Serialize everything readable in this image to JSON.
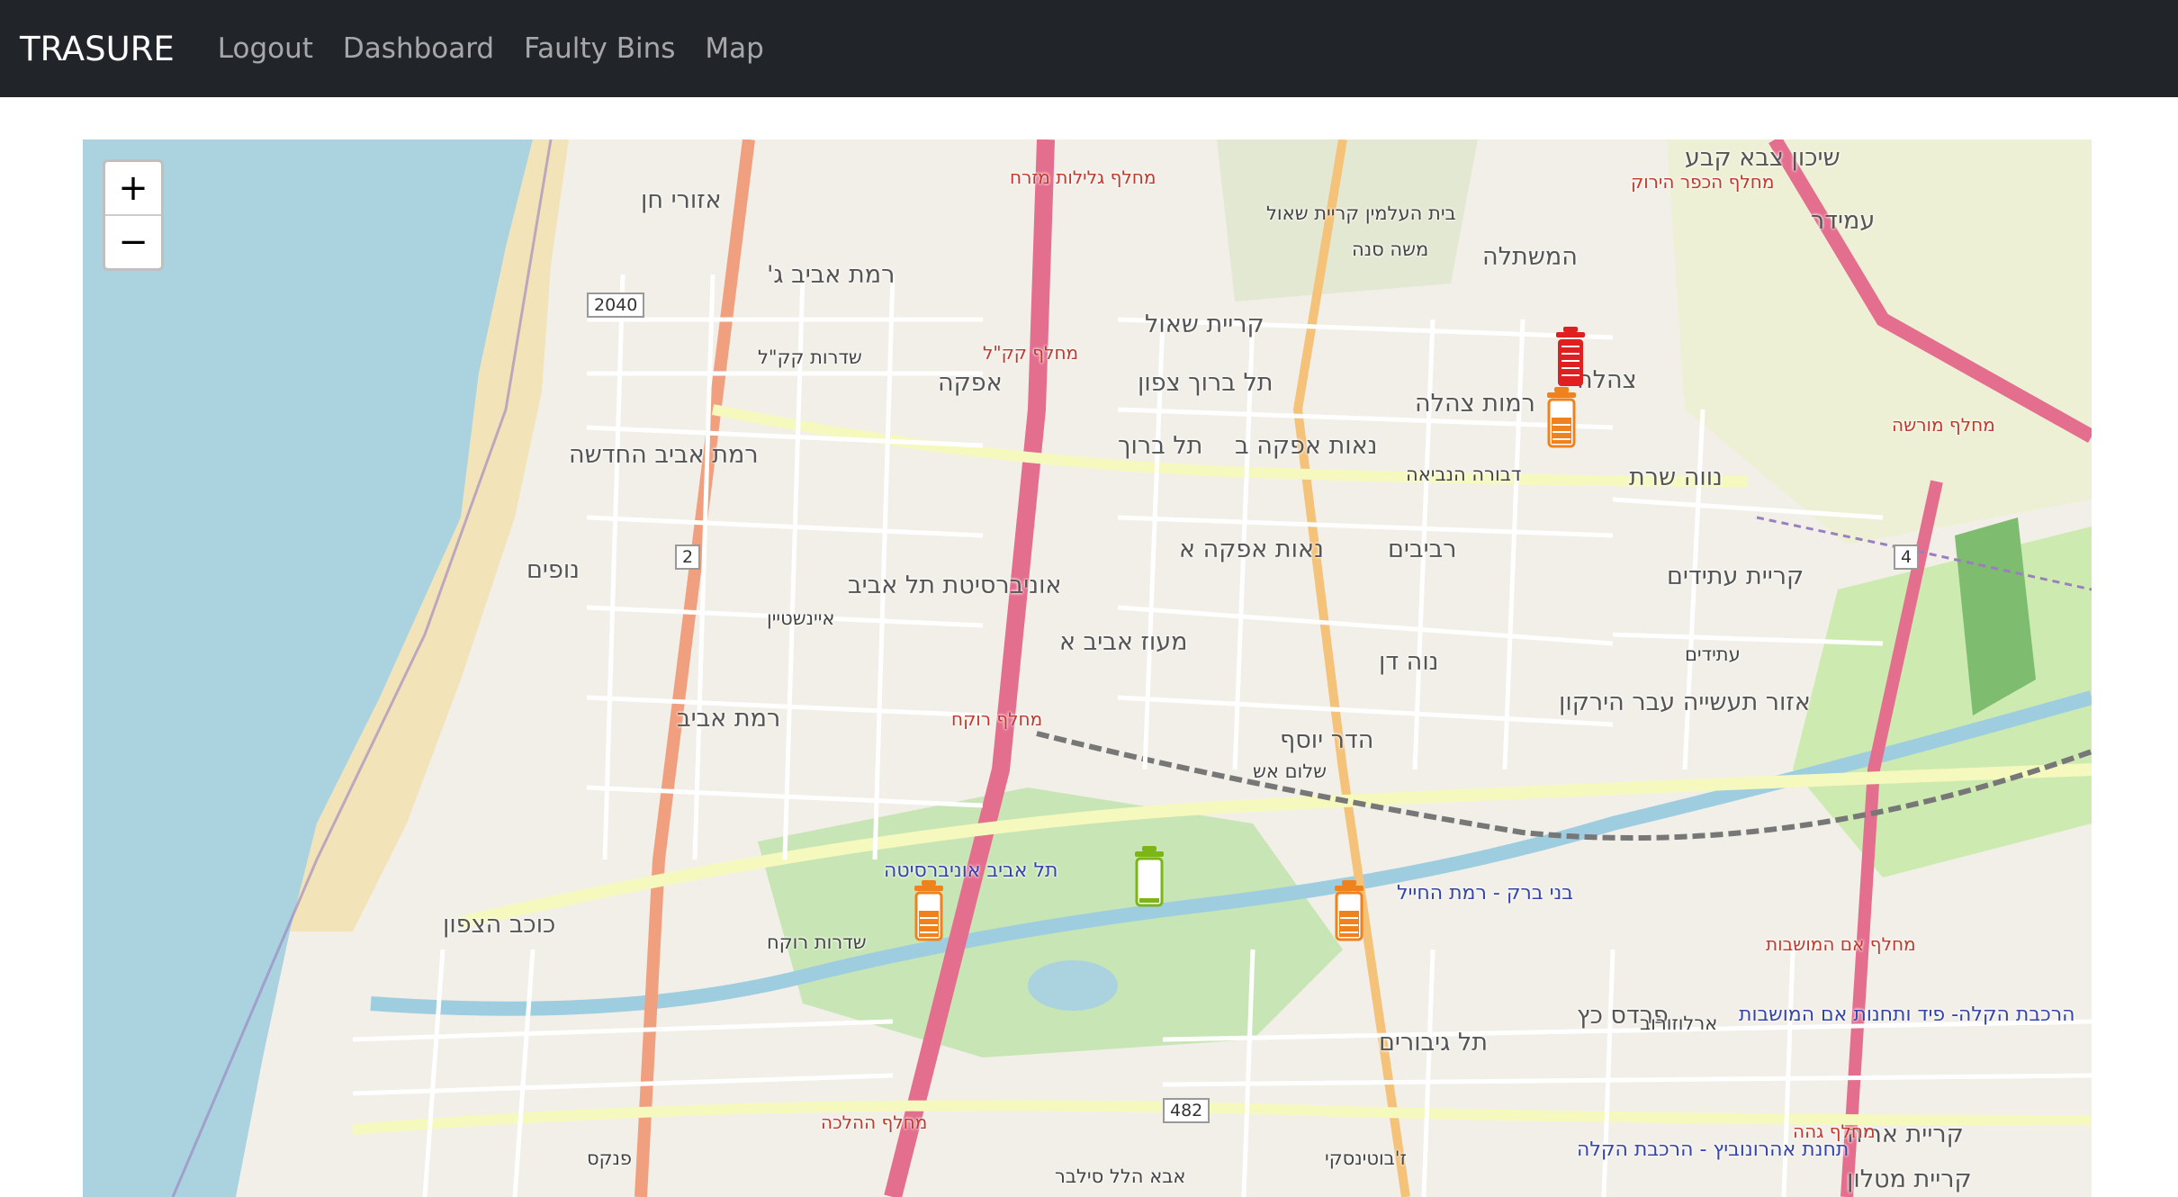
{
  "navbar": {
    "brand": "TRASURE",
    "links": [
      "Logout",
      "Dashboard",
      "Faulty Bins",
      "Map"
    ]
  },
  "map": {
    "zoom_in": "+",
    "zoom_out": "−",
    "place_labels": [
      "רמת אביב ג'",
      "אפקה",
      "רמת אביב החדשה",
      "נופים",
      "אוניברסיטת תל אביב",
      "רמת אביב",
      "כוכב הצפון",
      "קריית שאול",
      "תל ברוך צפון",
      "תל ברוך",
      "נאות אפקה ב",
      "נאות אפקה א",
      "מעוז אביב א",
      "הדר יוסף",
      "נווה שרת",
      "רמות צהלה",
      "צהלה",
      "המשתלה",
      "רביבים",
      "נוה דן",
      "קריית עתידים",
      "אזור תעשייה עבר הירקון",
      "עמידר",
      "בני ברק - רמת החייל",
      "פרדס כץ",
      "תל גיבורים",
      "קריית אריה",
      "קריית מטלון",
      "אזורי חן",
      "בית העלמין קריית שאול",
      "עתידים",
      "תל אביב אוניברסיטה",
      "שיכון צבא קבע"
    ],
    "street_labels": [
      "מחלף גלילות מזרח",
      "מחלף הכפר הירוק",
      "מחלף קק\"ל",
      "מחלף רוקח",
      "מחלף מורשה",
      "מחלף אם המושבות",
      "מחלף ההלכה",
      "מחלף גהה",
      "שדרות רוקח",
      "שדרות קק\"ל",
      "משה סנה",
      "דבורה הנביאה",
      "שלום אש",
      "איינשטיין",
      "הרכבת הקלה- פיד ותחנות אם המושבות",
      "תחנת אהרונוביץ - הרכבת הקלה",
      "אבא הלל סילבר",
      "ז'בוטינסקי",
      "פנקס",
      "ארלוזורוב"
    ],
    "road_numbers": [
      "2",
      "4",
      "482",
      "2040"
    ],
    "markers": [
      {
        "type": "full",
        "color": "#e02020"
      },
      {
        "type": "half",
        "color": "#f0821e"
      },
      {
        "type": "half",
        "color": "#f0821e"
      },
      {
        "type": "empty",
        "color": "#7cb518"
      },
      {
        "type": "half",
        "color": "#f0821e"
      }
    ]
  }
}
